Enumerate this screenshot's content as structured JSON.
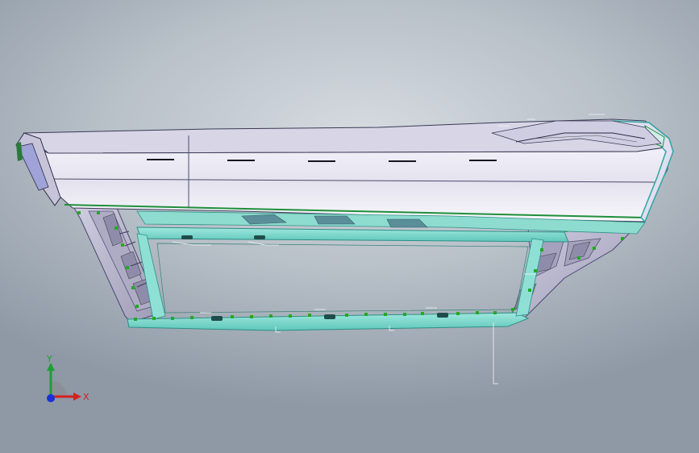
{
  "viewport": {
    "name": "cad-3d-viewport",
    "model": "car-bumper-assembly"
  },
  "triad": {
    "x_label": "X",
    "y_label": "Y",
    "x_color": "#d62020",
    "y_color": "#1f9e35",
    "z_color": "#1a2fd8"
  },
  "colors": {
    "body_surface": "#eceaf4",
    "frame_surface": "#7ad8cc",
    "frame_edge": "#2f8f86",
    "edge_line": "#3a3a55",
    "clip_green": "#22aa22",
    "lower_structure": "#b9b6cc"
  }
}
